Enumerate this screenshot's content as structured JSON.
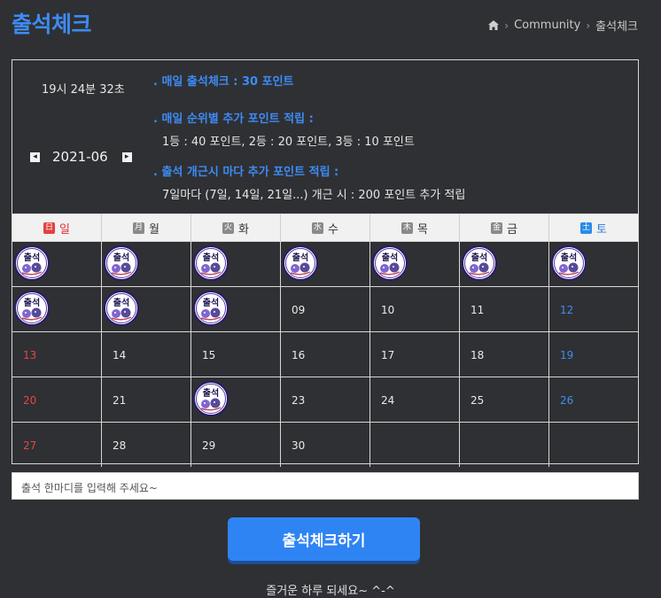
{
  "header": {
    "title": "출석체크",
    "breadcrumb": [
      "Community",
      "출석체크"
    ]
  },
  "clock": "19시 24분 32초",
  "month": {
    "label": "2021-06",
    "prev_icon": "left-arrow-icon",
    "next_icon": "right-arrow-icon"
  },
  "rules": {
    "daily_title": ". 매일 출석체크 : 30 포인트",
    "rank_title": ". 매일 순위별 추가 포인트 적립 :",
    "rank_body": "1등 : 40 포인트,  2등 : 20 포인트,  3등 : 10 포인트",
    "streak_title": ". 출석 개근시 마다 추가 포인트 적립 :",
    "streak_body": "7일마다 (7일, 14일, 21일...) 개근 시 : 200 포인트 추가 적립"
  },
  "calendar": {
    "weekdays": [
      {
        "kanji": "日",
        "name": "일"
      },
      {
        "kanji": "月",
        "name": "월"
      },
      {
        "kanji": "火",
        "name": "화"
      },
      {
        "kanji": "水",
        "name": "수"
      },
      {
        "kanji": "木",
        "name": "목"
      },
      {
        "kanji": "金",
        "name": "금"
      },
      {
        "kanji": "土",
        "name": "토"
      }
    ],
    "weeks": [
      [
        "stamp",
        "stamp",
        "stamp",
        "stamp",
        "stamp",
        "stamp",
        "stamp"
      ],
      [
        "stamp",
        "stamp",
        "stamp",
        "09",
        "10",
        "11",
        "12"
      ],
      [
        "13",
        "14",
        "15",
        "16",
        "17",
        "18",
        "19"
      ],
      [
        "20",
        "21",
        "stamp",
        "23",
        "24",
        "25",
        "26"
      ],
      [
        "27",
        "28",
        "29",
        "30",
        "",
        "",
        ""
      ]
    ],
    "stamp_text": "출석"
  },
  "comment": {
    "placeholder": "출석 한마디를 입력해 주세요~"
  },
  "check_button": "출석체크하기",
  "footer": "즐거운 하루 되세요~ ^-^",
  "colors": {
    "accent": "#3d8bf5",
    "background": "#2f3033",
    "sunday": "#e64545",
    "saturday": "#3f8ef0",
    "button": "#2f84f3"
  }
}
